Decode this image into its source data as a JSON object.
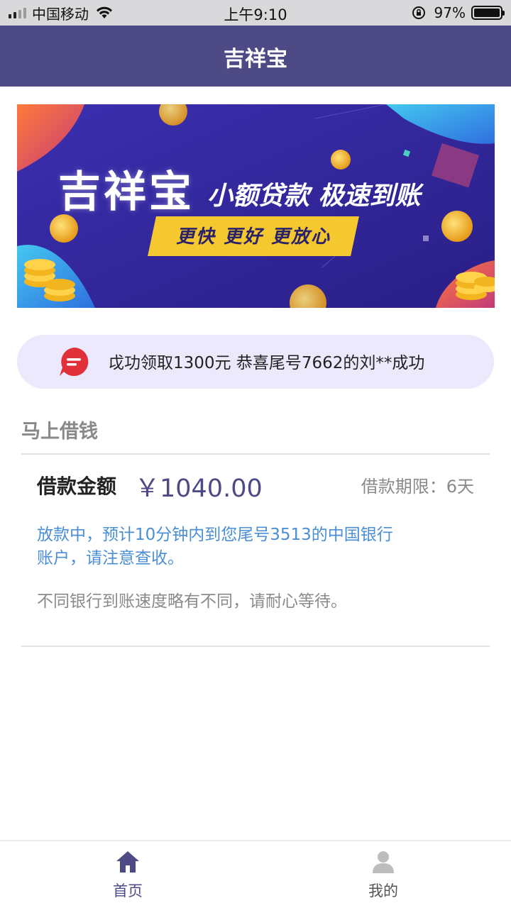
{
  "status_bar": {
    "carrier": "中国移动",
    "time": "上午9:10",
    "battery_percent": "97%"
  },
  "nav": {
    "title": "吉祥宝"
  },
  "banner": {
    "brand": "吉祥宝",
    "slogan": "小额贷款 极速到账",
    "tagline": "更快  更好  更放心"
  },
  "notice": {
    "icon": "message-icon",
    "text": "戉功领取1300元 恭喜尾号7662的刘**成功"
  },
  "section": {
    "title": "马上借钱"
  },
  "loan": {
    "label": "借款金额",
    "amount": "￥1040.00",
    "term": "借款期限：6天",
    "status_message": "放款中，预计10分钟内到您尾号3513的中国银行账户，请注意查收。",
    "hint": "不同银行到账速度略有不同，请耐心等待。"
  },
  "tabbar": {
    "items": [
      {
        "label": "首页",
        "icon": "home-icon",
        "active": true
      },
      {
        "label": "我的",
        "icon": "user-icon",
        "active": false
      }
    ]
  },
  "colors": {
    "nav_bg": "#4e4a86",
    "accent": "#4e4a86",
    "status_text": "#4a8fd6",
    "notice_bg": "#ebe9fb",
    "banner_bg": "#3a2a9e",
    "banner_pill": "#f6c830"
  }
}
